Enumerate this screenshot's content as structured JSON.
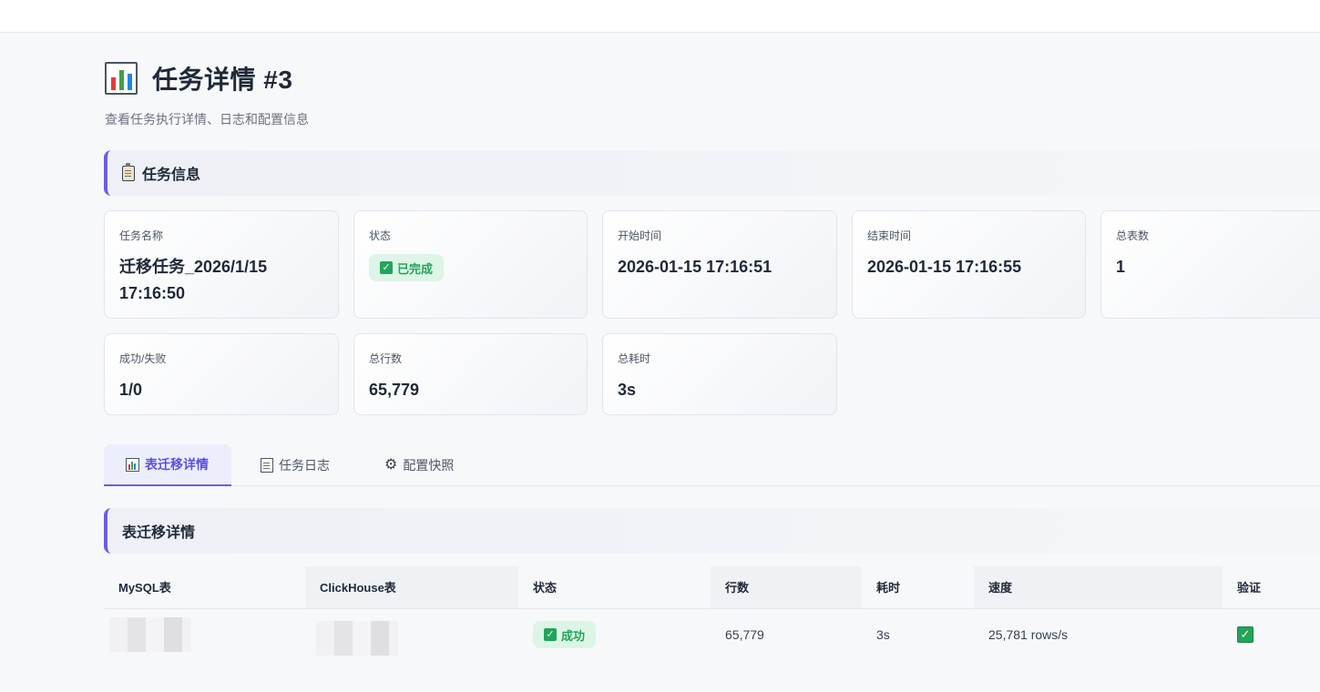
{
  "header": {
    "title": "任务详情 #3",
    "subtitle": "查看任务执行详情、日志和配置信息"
  },
  "info_section": {
    "title": "任务信息"
  },
  "cards": {
    "task_name": {
      "label": "任务名称",
      "value": "迁移任务_2026/1/15 17:16:50"
    },
    "status": {
      "label": "状态",
      "value": "已完成"
    },
    "start_time": {
      "label": "开始时间",
      "value": "2026-01-15 17:16:51"
    },
    "end_time": {
      "label": "结束时间",
      "value": "2026-01-15 17:16:55"
    },
    "total_tables": {
      "label": "总表数",
      "value": "1"
    },
    "success_fail": {
      "label": "成功/失败",
      "value": "1/0"
    },
    "total_rows": {
      "label": "总行数",
      "value": "65,779"
    },
    "total_time": {
      "label": "总耗时",
      "value": "3s"
    }
  },
  "tabs": [
    {
      "label": "表迁移详情",
      "icon": "chart-icon",
      "active": true
    },
    {
      "label": "任务日志",
      "icon": "memo-icon",
      "active": false
    },
    {
      "label": "配置快照",
      "icon": "gear-icon",
      "active": false
    }
  ],
  "table_section": {
    "title": "表迁移详情"
  },
  "table": {
    "columns": [
      "MySQL表",
      "ClickHouse表",
      "状态",
      "行数",
      "耗时",
      "速度",
      "验证"
    ],
    "rows": [
      {
        "mysql": "",
        "clickhouse": "",
        "status": "成功",
        "rows": "65,779",
        "time": "3s",
        "speed": "25,781 rows/s",
        "verified": "✓"
      }
    ]
  },
  "colors": {
    "accent": "#6c5ce7",
    "success": "#22a55a",
    "success_bg": "#dcf5e6"
  }
}
